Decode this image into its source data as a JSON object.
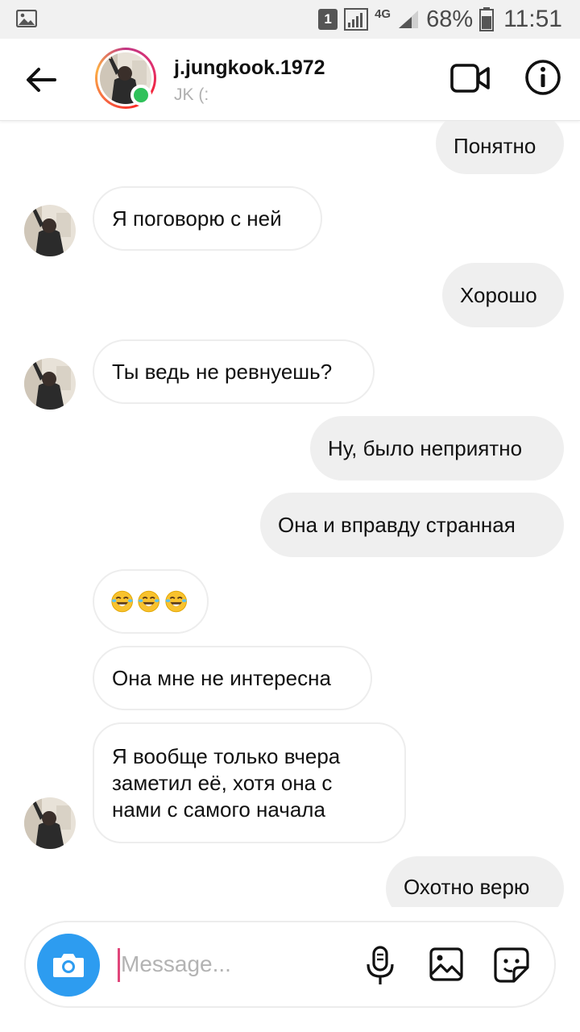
{
  "status_bar": {
    "sim_slot": "1",
    "network": "4G",
    "battery": "68%",
    "time": "11:51"
  },
  "header": {
    "username": "j.jungkook.1972",
    "subtitle": "JK (:",
    "online": true
  },
  "messages": [
    {
      "side": "sent",
      "text": "Понятно"
    },
    {
      "side": "received",
      "text": "Я поговорю с ней",
      "avatar": true
    },
    {
      "side": "sent",
      "text": "Хорошо"
    },
    {
      "side": "received",
      "text": "Ты ведь не ревнуешь?",
      "avatar": true
    },
    {
      "side": "sent",
      "text": "Ну, было неприятно"
    },
    {
      "side": "sent",
      "text": "Она и вправду странная"
    },
    {
      "side": "received",
      "text": "",
      "emoji": [
        "rofl-emoji",
        "rofl-emoji",
        "rofl-emoji"
      ],
      "avatar": false
    },
    {
      "side": "received",
      "text": "Она мне не интересна",
      "avatar": false
    },
    {
      "side": "received",
      "text": " Я вообще только вчера\nзаметил её, хотя она с\nнами с самого начала",
      "avatar": true
    },
    {
      "side": "sent",
      "text": "Охотно верю"
    }
  ],
  "composer": {
    "placeholder": "Message...",
    "icons": [
      "camera-icon",
      "microphone-icon",
      "gallery-icon",
      "sticker-icon"
    ]
  },
  "colors": {
    "sent_bubble": "#efefef",
    "camera_button": "#2d9cf0",
    "online_dot": "#2fc15a",
    "caret": "#e0467a"
  }
}
